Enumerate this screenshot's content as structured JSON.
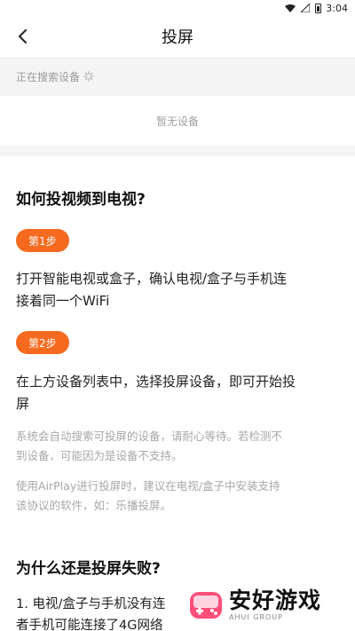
{
  "status_bar": {
    "time": "3:04"
  },
  "header": {
    "title": "投屏",
    "back_icon": "chevron-left-icon"
  },
  "search": {
    "status": "正在搜索设备",
    "spinner_icon": "spinner-icon"
  },
  "devices": {
    "empty_text": "暂无设备"
  },
  "help": {
    "title": "如何投视频到电视?",
    "steps": [
      {
        "badge": "第1步",
        "line1": "打开智能电视或盒子，确认电视/盒子与手机连",
        "line2": "接着同一个WiFi"
      },
      {
        "badge": "第2步",
        "line1": "在上方设备列表中，选择投屏设备，即可开始投",
        "line2": "屏"
      }
    ],
    "notes": [
      {
        "line1": "系统会自动搜索可投屏的设备，请耐心等待。若检测不",
        "line2": "到设备，可能因为是设备不支持。"
      },
      {
        "line1": "使用AirPlay进行投屏时，建议在电视/盒子中安装支持",
        "line2": "该协议的软件，如：乐播投屏。"
      }
    ]
  },
  "fail": {
    "title": "为什么还是投屏失败?",
    "line1": "1. 电视/盒子与手机没有连",
    "line2": "者手机可能连接了4G网络"
  },
  "watermark": {
    "main": "安好游戏",
    "sub": "AHUI GROUP"
  },
  "colors": {
    "accent": "#f56a1f",
    "bg": "#f4f4f4"
  }
}
